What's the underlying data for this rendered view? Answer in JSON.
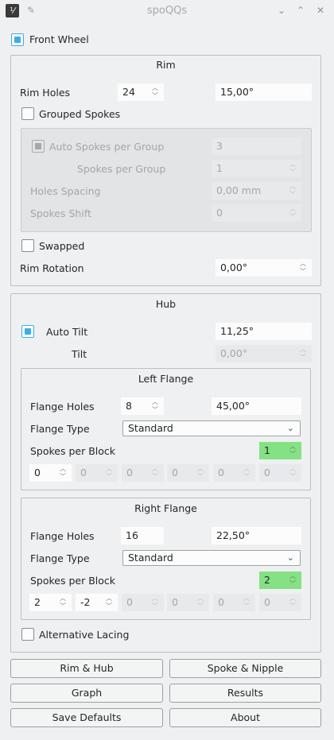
{
  "window": {
    "title": "spoQQs"
  },
  "front_wheel": {
    "label": "Front Wheel",
    "checked": true
  },
  "rim": {
    "title": "Rim",
    "rim_holes_label": "Rim Holes",
    "rim_holes_value": "24",
    "rim_holes_angle": "15,00°",
    "grouped_spokes_label": "Grouped Spokes",
    "auto_spokes_label": "Auto Spokes per Group",
    "auto_spokes_value": "3",
    "spokes_per_group_label": "Spokes per Group",
    "spokes_per_group_value": "1",
    "holes_spacing_label": "Holes Spacing",
    "holes_spacing_value": "0,00 mm",
    "spokes_shift_label": "Spokes Shift",
    "spokes_shift_value": "0",
    "swapped_label": "Swapped",
    "rim_rotation_label": "Rim Rotation",
    "rim_rotation_value": "0,00°"
  },
  "hub": {
    "title": "Hub",
    "auto_tilt_label": "Auto Tilt",
    "auto_tilt_value": "11,25°",
    "tilt_label": "Tilt",
    "tilt_value": "0,00°",
    "left_flange": {
      "title": "Left Flange",
      "flange_holes_label": "Flange Holes",
      "flange_holes_value": "8",
      "flange_holes_angle": "45,00°",
      "flange_type_label": "Flange Type",
      "flange_type_value": "Standard",
      "spokes_per_block_label": "Spokes per Block",
      "spokes_per_block_value": "1",
      "blocks": [
        "0",
        "0",
        "0",
        "0",
        "0",
        "0"
      ]
    },
    "right_flange": {
      "title": "Right Flange",
      "flange_holes_label": "Flange Holes",
      "flange_holes_value": "16",
      "flange_holes_angle": "22,50°",
      "flange_type_label": "Flange Type",
      "flange_type_value": "Standard",
      "spokes_per_block_label": "Spokes per Block",
      "spokes_per_block_value": "2",
      "blocks": [
        "2",
        "-2",
        "0",
        "0",
        "0",
        "0"
      ]
    },
    "alternative_lacing_label": "Alternative Lacing"
  },
  "buttons": {
    "rim_hub": "Rim & Hub",
    "spoke_nipple": "Spoke & Nipple",
    "graph": "Graph",
    "results": "Results",
    "save_defaults": "Save Defaults",
    "about": "About"
  },
  "colors": {
    "accent": "#3daee9",
    "highlight_field": "#84e184",
    "background": "#eff0f1"
  }
}
